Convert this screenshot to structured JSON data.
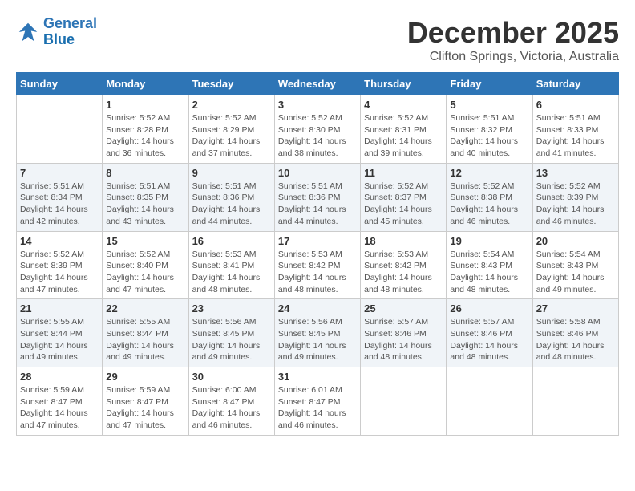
{
  "logo": {
    "line1": "General",
    "line2": "Blue"
  },
  "title": "December 2025",
  "location": "Clifton Springs, Victoria, Australia",
  "days_of_week": [
    "Sunday",
    "Monday",
    "Tuesday",
    "Wednesday",
    "Thursday",
    "Friday",
    "Saturday"
  ],
  "weeks": [
    [
      {
        "day": "",
        "content": ""
      },
      {
        "day": "1",
        "content": "Sunrise: 5:52 AM\nSunset: 8:28 PM\nDaylight: 14 hours\nand 36 minutes."
      },
      {
        "day": "2",
        "content": "Sunrise: 5:52 AM\nSunset: 8:29 PM\nDaylight: 14 hours\nand 37 minutes."
      },
      {
        "day": "3",
        "content": "Sunrise: 5:52 AM\nSunset: 8:30 PM\nDaylight: 14 hours\nand 38 minutes."
      },
      {
        "day": "4",
        "content": "Sunrise: 5:52 AM\nSunset: 8:31 PM\nDaylight: 14 hours\nand 39 minutes."
      },
      {
        "day": "5",
        "content": "Sunrise: 5:51 AM\nSunset: 8:32 PM\nDaylight: 14 hours\nand 40 minutes."
      },
      {
        "day": "6",
        "content": "Sunrise: 5:51 AM\nSunset: 8:33 PM\nDaylight: 14 hours\nand 41 minutes."
      }
    ],
    [
      {
        "day": "7",
        "content": "Sunrise: 5:51 AM\nSunset: 8:34 PM\nDaylight: 14 hours\nand 42 minutes."
      },
      {
        "day": "8",
        "content": "Sunrise: 5:51 AM\nSunset: 8:35 PM\nDaylight: 14 hours\nand 43 minutes."
      },
      {
        "day": "9",
        "content": "Sunrise: 5:51 AM\nSunset: 8:36 PM\nDaylight: 14 hours\nand 44 minutes."
      },
      {
        "day": "10",
        "content": "Sunrise: 5:51 AM\nSunset: 8:36 PM\nDaylight: 14 hours\nand 44 minutes."
      },
      {
        "day": "11",
        "content": "Sunrise: 5:52 AM\nSunset: 8:37 PM\nDaylight: 14 hours\nand 45 minutes."
      },
      {
        "day": "12",
        "content": "Sunrise: 5:52 AM\nSunset: 8:38 PM\nDaylight: 14 hours\nand 46 minutes."
      },
      {
        "day": "13",
        "content": "Sunrise: 5:52 AM\nSunset: 8:39 PM\nDaylight: 14 hours\nand 46 minutes."
      }
    ],
    [
      {
        "day": "14",
        "content": "Sunrise: 5:52 AM\nSunset: 8:39 PM\nDaylight: 14 hours\nand 47 minutes."
      },
      {
        "day": "15",
        "content": "Sunrise: 5:52 AM\nSunset: 8:40 PM\nDaylight: 14 hours\nand 47 minutes."
      },
      {
        "day": "16",
        "content": "Sunrise: 5:53 AM\nSunset: 8:41 PM\nDaylight: 14 hours\nand 48 minutes."
      },
      {
        "day": "17",
        "content": "Sunrise: 5:53 AM\nSunset: 8:42 PM\nDaylight: 14 hours\nand 48 minutes."
      },
      {
        "day": "18",
        "content": "Sunrise: 5:53 AM\nSunset: 8:42 PM\nDaylight: 14 hours\nand 48 minutes."
      },
      {
        "day": "19",
        "content": "Sunrise: 5:54 AM\nSunset: 8:43 PM\nDaylight: 14 hours\nand 48 minutes."
      },
      {
        "day": "20",
        "content": "Sunrise: 5:54 AM\nSunset: 8:43 PM\nDaylight: 14 hours\nand 49 minutes."
      }
    ],
    [
      {
        "day": "21",
        "content": "Sunrise: 5:55 AM\nSunset: 8:44 PM\nDaylight: 14 hours\nand 49 minutes."
      },
      {
        "day": "22",
        "content": "Sunrise: 5:55 AM\nSunset: 8:44 PM\nDaylight: 14 hours\nand 49 minutes."
      },
      {
        "day": "23",
        "content": "Sunrise: 5:56 AM\nSunset: 8:45 PM\nDaylight: 14 hours\nand 49 minutes."
      },
      {
        "day": "24",
        "content": "Sunrise: 5:56 AM\nSunset: 8:45 PM\nDaylight: 14 hours\nand 49 minutes."
      },
      {
        "day": "25",
        "content": "Sunrise: 5:57 AM\nSunset: 8:46 PM\nDaylight: 14 hours\nand 48 minutes."
      },
      {
        "day": "26",
        "content": "Sunrise: 5:57 AM\nSunset: 8:46 PM\nDaylight: 14 hours\nand 48 minutes."
      },
      {
        "day": "27",
        "content": "Sunrise: 5:58 AM\nSunset: 8:46 PM\nDaylight: 14 hours\nand 48 minutes."
      }
    ],
    [
      {
        "day": "28",
        "content": "Sunrise: 5:59 AM\nSunset: 8:47 PM\nDaylight: 14 hours\nand 47 minutes."
      },
      {
        "day": "29",
        "content": "Sunrise: 5:59 AM\nSunset: 8:47 PM\nDaylight: 14 hours\nand 47 minutes."
      },
      {
        "day": "30",
        "content": "Sunrise: 6:00 AM\nSunset: 8:47 PM\nDaylight: 14 hours\nand 46 minutes."
      },
      {
        "day": "31",
        "content": "Sunrise: 6:01 AM\nSunset: 8:47 PM\nDaylight: 14 hours\nand 46 minutes."
      },
      {
        "day": "",
        "content": ""
      },
      {
        "day": "",
        "content": ""
      },
      {
        "day": "",
        "content": ""
      }
    ]
  ]
}
